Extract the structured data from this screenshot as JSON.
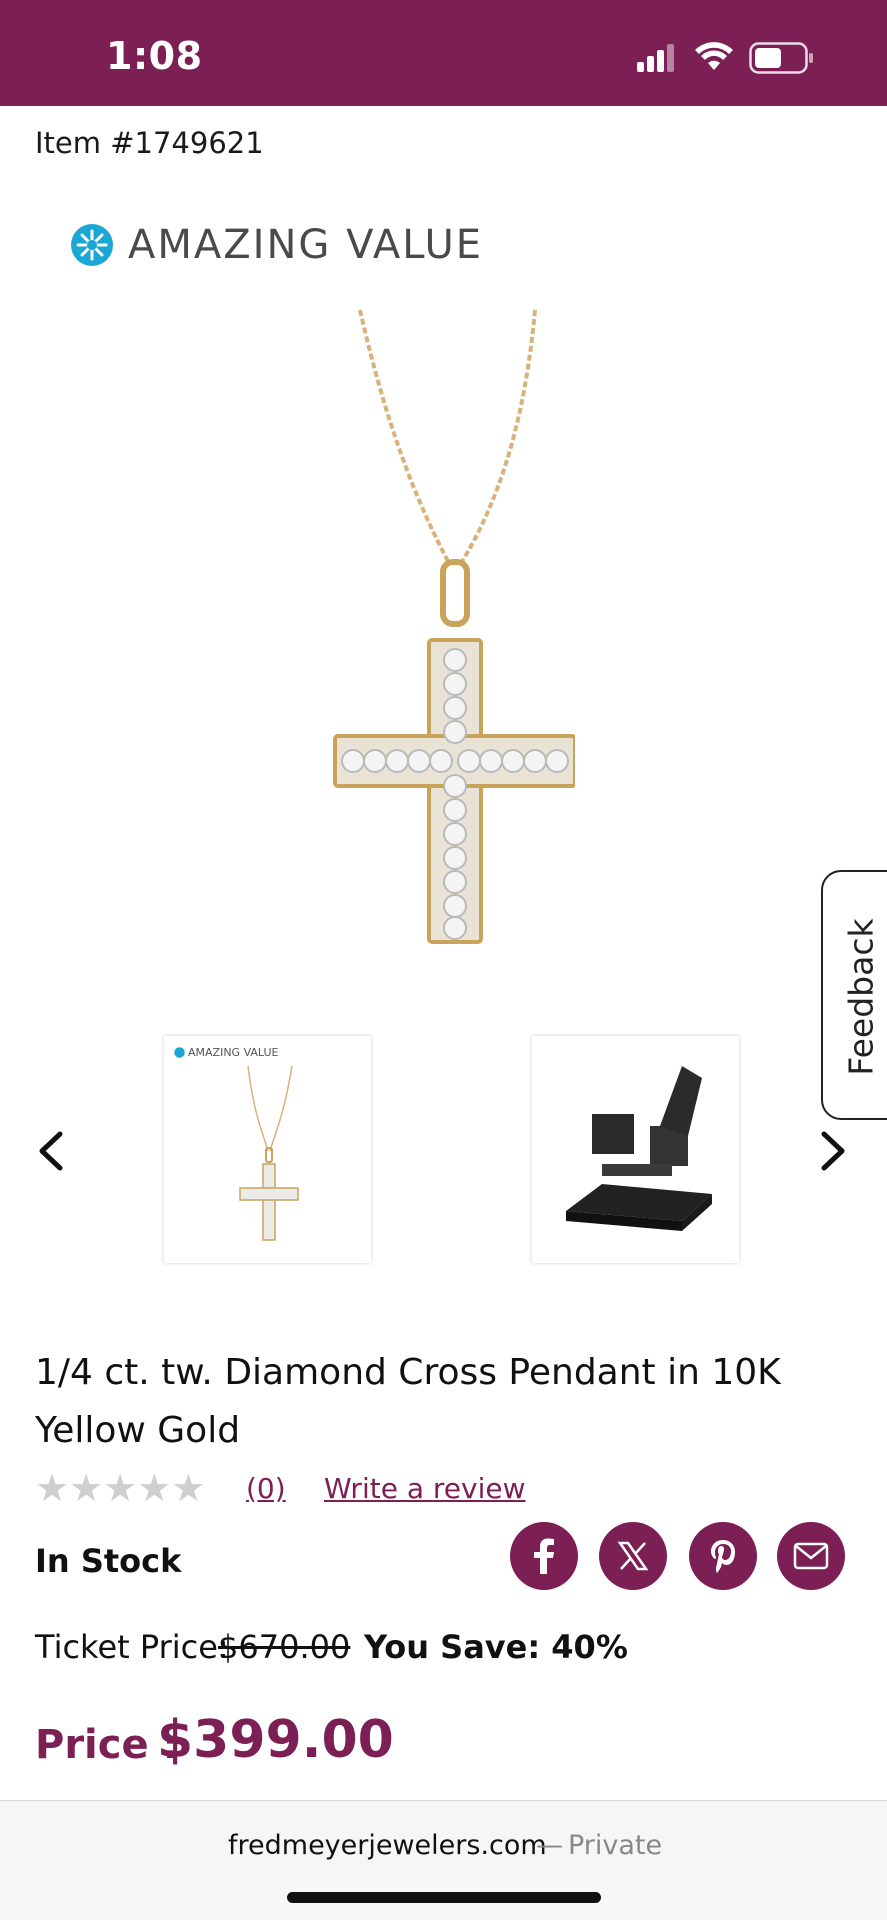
{
  "status_bar": {
    "time": "1:08",
    "bg_color": "#7b1f55"
  },
  "item": {
    "number": "Item #1749621"
  },
  "badge": {
    "text": "AMAZING VALUE",
    "icon": "starburst-icon",
    "color": "#1aa7d4"
  },
  "feedback": {
    "label": "Feedback"
  },
  "carousel": {
    "prev_icon": "chevron-left-icon",
    "next_icon": "chevron-right-icon",
    "thumbnails": [
      {
        "badge": "AMAZING VALUE"
      },
      {
        "badge": ""
      }
    ]
  },
  "product": {
    "title": "1/4 ct. tw. Diamond Cross Pendant in 10K Yellow Gold",
    "review_count": "(0)",
    "write_review": "Write a review",
    "rating": 0,
    "rating_max": 5,
    "stock_status": "In Stock",
    "ticket_price_label": "Ticket Price:",
    "ticket_price": "$670.00",
    "you_save": "You Save: 40%",
    "price_label": "Price :",
    "price": "$399.00"
  },
  "share": {
    "icons": [
      "facebook-icon",
      "x-icon",
      "pinterest-icon",
      "mail-icon"
    ]
  },
  "browser": {
    "host": "fredmeyerjewelers.com",
    "separator": "—",
    "mode": "Private"
  },
  "colors": {
    "accent": "#7b1f55",
    "gold": "#d4a85c",
    "star_empty": "#cfcfcf"
  }
}
